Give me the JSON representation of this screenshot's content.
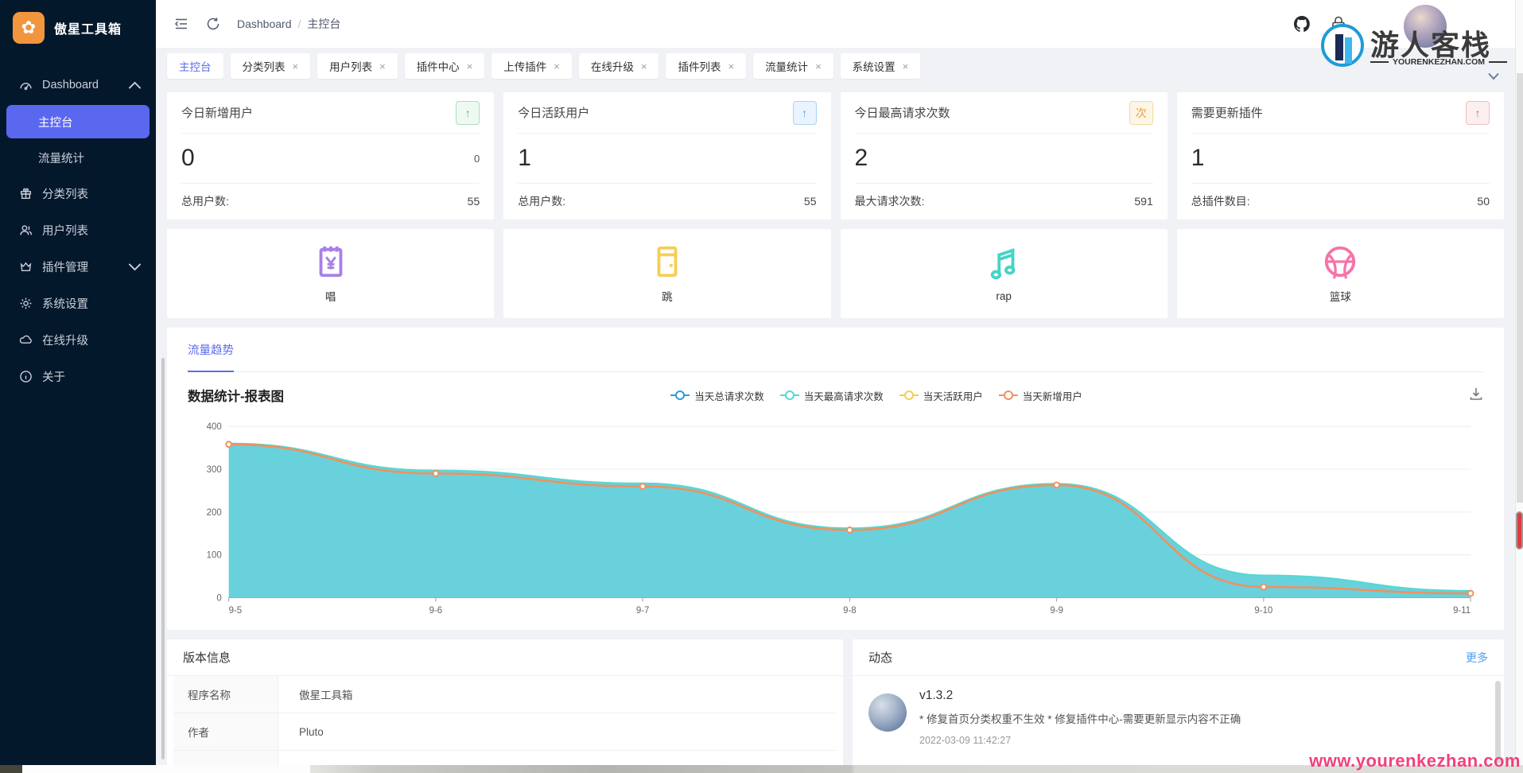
{
  "ui": {
    "close_glyph": "×",
    "up_glyph": "↑"
  },
  "app": {
    "title": "傲星工具箱",
    "logo_glyph": "✿"
  },
  "colors": {
    "sidebar_bg": "#04182B",
    "active_item_bg": "#5A68F0",
    "accent_blue": "#5B6BF0",
    "content_bg": "#F0F2F5",
    "logo_orange": "#F2953F",
    "badge_green": "#43B97A",
    "badge_blue": "#4A9FF0",
    "badge_orange": "#E6A23C",
    "badge_red": "#E35D5D"
  },
  "header": {
    "breadcrumb": {
      "root": "Dashboard",
      "separator": "/",
      "current": "主控台"
    }
  },
  "sidebar": {
    "items": [
      {
        "label": "Dashboard",
        "icon": "dashboard-gauge-icon",
        "expanded": true,
        "children": [
          {
            "label": "主控台",
            "active": true
          },
          {
            "label": "流量统计"
          }
        ]
      },
      {
        "label": "分类列表",
        "icon": "gift-icon"
      },
      {
        "label": "用户列表",
        "icon": "users-icon"
      },
      {
        "label": "插件管理",
        "icon": "crown-icon",
        "collapsed": true
      },
      {
        "label": "系统设置",
        "icon": "gear-icon"
      },
      {
        "label": "在线升级",
        "icon": "cloud-icon"
      },
      {
        "label": "关于",
        "icon": "info-icon"
      }
    ]
  },
  "tabs": [
    {
      "label": "主控台",
      "active": true,
      "closable": false
    },
    {
      "label": "分类列表",
      "closable": true
    },
    {
      "label": "用户列表",
      "closable": true
    },
    {
      "label": "插件中心",
      "closable": true
    },
    {
      "label": "上传插件",
      "closable": true
    },
    {
      "label": "在线升级",
      "closable": true
    },
    {
      "label": "插件列表",
      "closable": true
    },
    {
      "label": "流量统计",
      "closable": true
    },
    {
      "label": "系统设置",
      "closable": true
    }
  ],
  "stat_cards": [
    {
      "title": "今日新增用户",
      "badge": {
        "text": "↑",
        "color": "#43B97A"
      },
      "value": "0",
      "sub_value": "0",
      "footer_label": "总用户数:",
      "footer_value": "55"
    },
    {
      "title": "今日活跃用户",
      "badge": {
        "text": "↑",
        "color": "#4A9FF0"
      },
      "value": "1",
      "footer_label": "总用户数:",
      "footer_value": "55"
    },
    {
      "title": "今日最高请求次数",
      "badge": {
        "text": "次",
        "color": "#E6A23C"
      },
      "value": "2",
      "footer_label": "最大请求次数:",
      "footer_value": "591"
    },
    {
      "title": "需要更新插件",
      "badge": {
        "text": "↑",
        "color": "#E35D5D"
      },
      "value": "1",
      "footer_label": "总插件数目:",
      "footer_value": "50"
    }
  ],
  "feature_cards": [
    {
      "label": "唱",
      "icon": "yen-billing-icon",
      "color": "#A97FE8"
    },
    {
      "label": "跳",
      "icon": "card-machine-icon",
      "color": "#F7CE51"
    },
    {
      "label": "rap",
      "icon": "music-note-icon",
      "color": "#45D4C8"
    },
    {
      "label": "篮球",
      "icon": "basketball-icon",
      "color": "#F673A8"
    }
  ],
  "traffic_panel": {
    "tab_label": "流量趋势",
    "title": "数据统计-报表图"
  },
  "chart_data": {
    "type": "area",
    "title": "数据统计-报表图",
    "categories": [
      "9-5",
      "9-6",
      "9-7",
      "9-8",
      "9-9",
      "9-10",
      "9-11"
    ],
    "ylim": [
      0,
      400
    ],
    "ytick_step": 100,
    "grid": true,
    "legend_position": "top",
    "series": [
      {
        "name": "当天总请求次数",
        "color": "#2D9CDB",
        "style": "line",
        "visible": false,
        "values": null
      },
      {
        "name": "当天最高请求次数",
        "color": "#55D8D2",
        "fill": "#62CFDB",
        "style": "area",
        "visible": true,
        "values": [
          360,
          297,
          267,
          162,
          266,
          52,
          16
        ]
      },
      {
        "name": "当天活跃用户",
        "color": "#F6CE4F",
        "style": "line",
        "visible": false,
        "values": null
      },
      {
        "name": "当天新增用户",
        "color": "#F0915F",
        "style": "line",
        "visible": true,
        "values": [
          358,
          290,
          260,
          158,
          263,
          25,
          10
        ]
      }
    ]
  },
  "version_panel": {
    "title": "版本信息",
    "rows": [
      {
        "label": "程序名称",
        "value": "傲星工具箱"
      },
      {
        "label": "作者",
        "value": "Pluto"
      }
    ]
  },
  "activity_panel": {
    "title": "动态",
    "more_label": "更多",
    "items": [
      {
        "version": "v1.3.2",
        "description": "* 修复首页分类权重不生效 * 修复插件中心-需要更新显示内容不正确",
        "time": "2022-03-09 11:42:27"
      }
    ]
  },
  "watermark": {
    "site_name": "游人客栈",
    "site_domain": "YOURENKEZHAN.COM",
    "url_text": "www.yourenkezhan.com",
    "accent": "#1E9CD7",
    "url_color": "#F2407B"
  }
}
